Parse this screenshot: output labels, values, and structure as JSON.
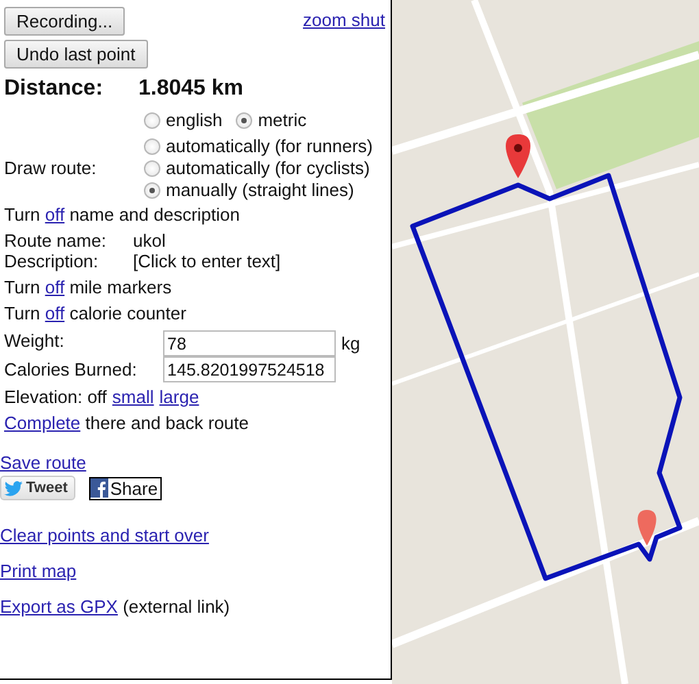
{
  "record_button": "Recording...",
  "zoom_link": "zoom shut",
  "undo_button": "Undo last point",
  "distance": {
    "label": "Distance:",
    "value": "1.8045 km"
  },
  "units": [
    {
      "label": "english",
      "selected": false
    },
    {
      "label": "metric",
      "selected": true
    }
  ],
  "draw_route": {
    "label": "Draw route:",
    "options": [
      {
        "label": "automatically (for runners)",
        "selected": false
      },
      {
        "label": "automatically (for cyclists)",
        "selected": false
      },
      {
        "label": "manually (straight lines)",
        "selected": true
      }
    ]
  },
  "name_toggle": {
    "before": "Turn",
    "link": "off",
    "after": "name and description"
  },
  "route_fields": [
    {
      "label": "Route name:",
      "value": "ukol"
    },
    {
      "label": "Description:",
      "value": "[Click to enter text]"
    }
  ],
  "mile_toggle": {
    "before": "Turn",
    "link": "off",
    "after": "mile markers"
  },
  "calorie_toggle": {
    "before": "Turn",
    "link": "off",
    "after": "calorie counter"
  },
  "weight": {
    "label": "Weight:",
    "value": "78",
    "unit": "kg"
  },
  "calories": {
    "label": "Calories Burned:",
    "value": "145.8201997524518"
  },
  "elevation": {
    "label": "Elevation: off",
    "links": [
      "small",
      "large"
    ]
  },
  "complete": {
    "link": "Complete",
    "after": "there and back route"
  },
  "save_link": "Save route",
  "tweet_button": "Tweet",
  "share_button": "Share",
  "clear_link": "Clear points and start over",
  "print_link": "Print map",
  "export": {
    "link": "Export as GPX",
    "after": "(external link)"
  }
}
